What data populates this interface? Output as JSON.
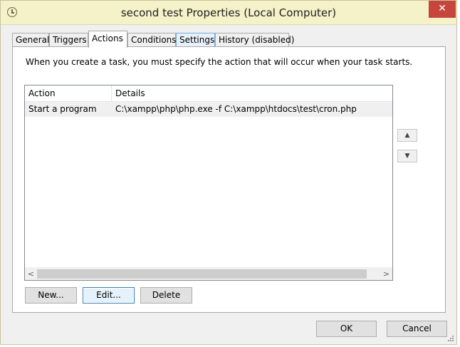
{
  "window": {
    "title": "second test Properties (Local Computer)",
    "close_glyph": "✕"
  },
  "tabs": [
    {
      "label": "General"
    },
    {
      "label": "Triggers"
    },
    {
      "label": "Actions"
    },
    {
      "label": "Conditions"
    },
    {
      "label": "Settings"
    },
    {
      "label": "History (disabled)"
    }
  ],
  "active_tab": "Actions",
  "pane": {
    "description": "When you create a task, you must specify the action that will occur when your task starts."
  },
  "actions_list": {
    "columns": [
      "Action",
      "Details"
    ],
    "rows": [
      {
        "action": "Start a program",
        "details": "C:\\xampp\\php\\php.exe -f C:\\xampp\\htdocs\\test\\cron.php"
      }
    ]
  },
  "buttons": {
    "new": "New...",
    "edit": "Edit...",
    "delete": "Delete",
    "ok": "OK",
    "cancel": "Cancel",
    "move_up": "▲",
    "move_down": "▼",
    "scroll_left": "<",
    "scroll_right": ">"
  },
  "icons": {
    "title": "task-scheduler-clock-icon",
    "close": "close-icon"
  },
  "colors": {
    "titlebar": "#f5f1c8",
    "close": "#c7463b",
    "focus_border": "#3c7fb1"
  }
}
